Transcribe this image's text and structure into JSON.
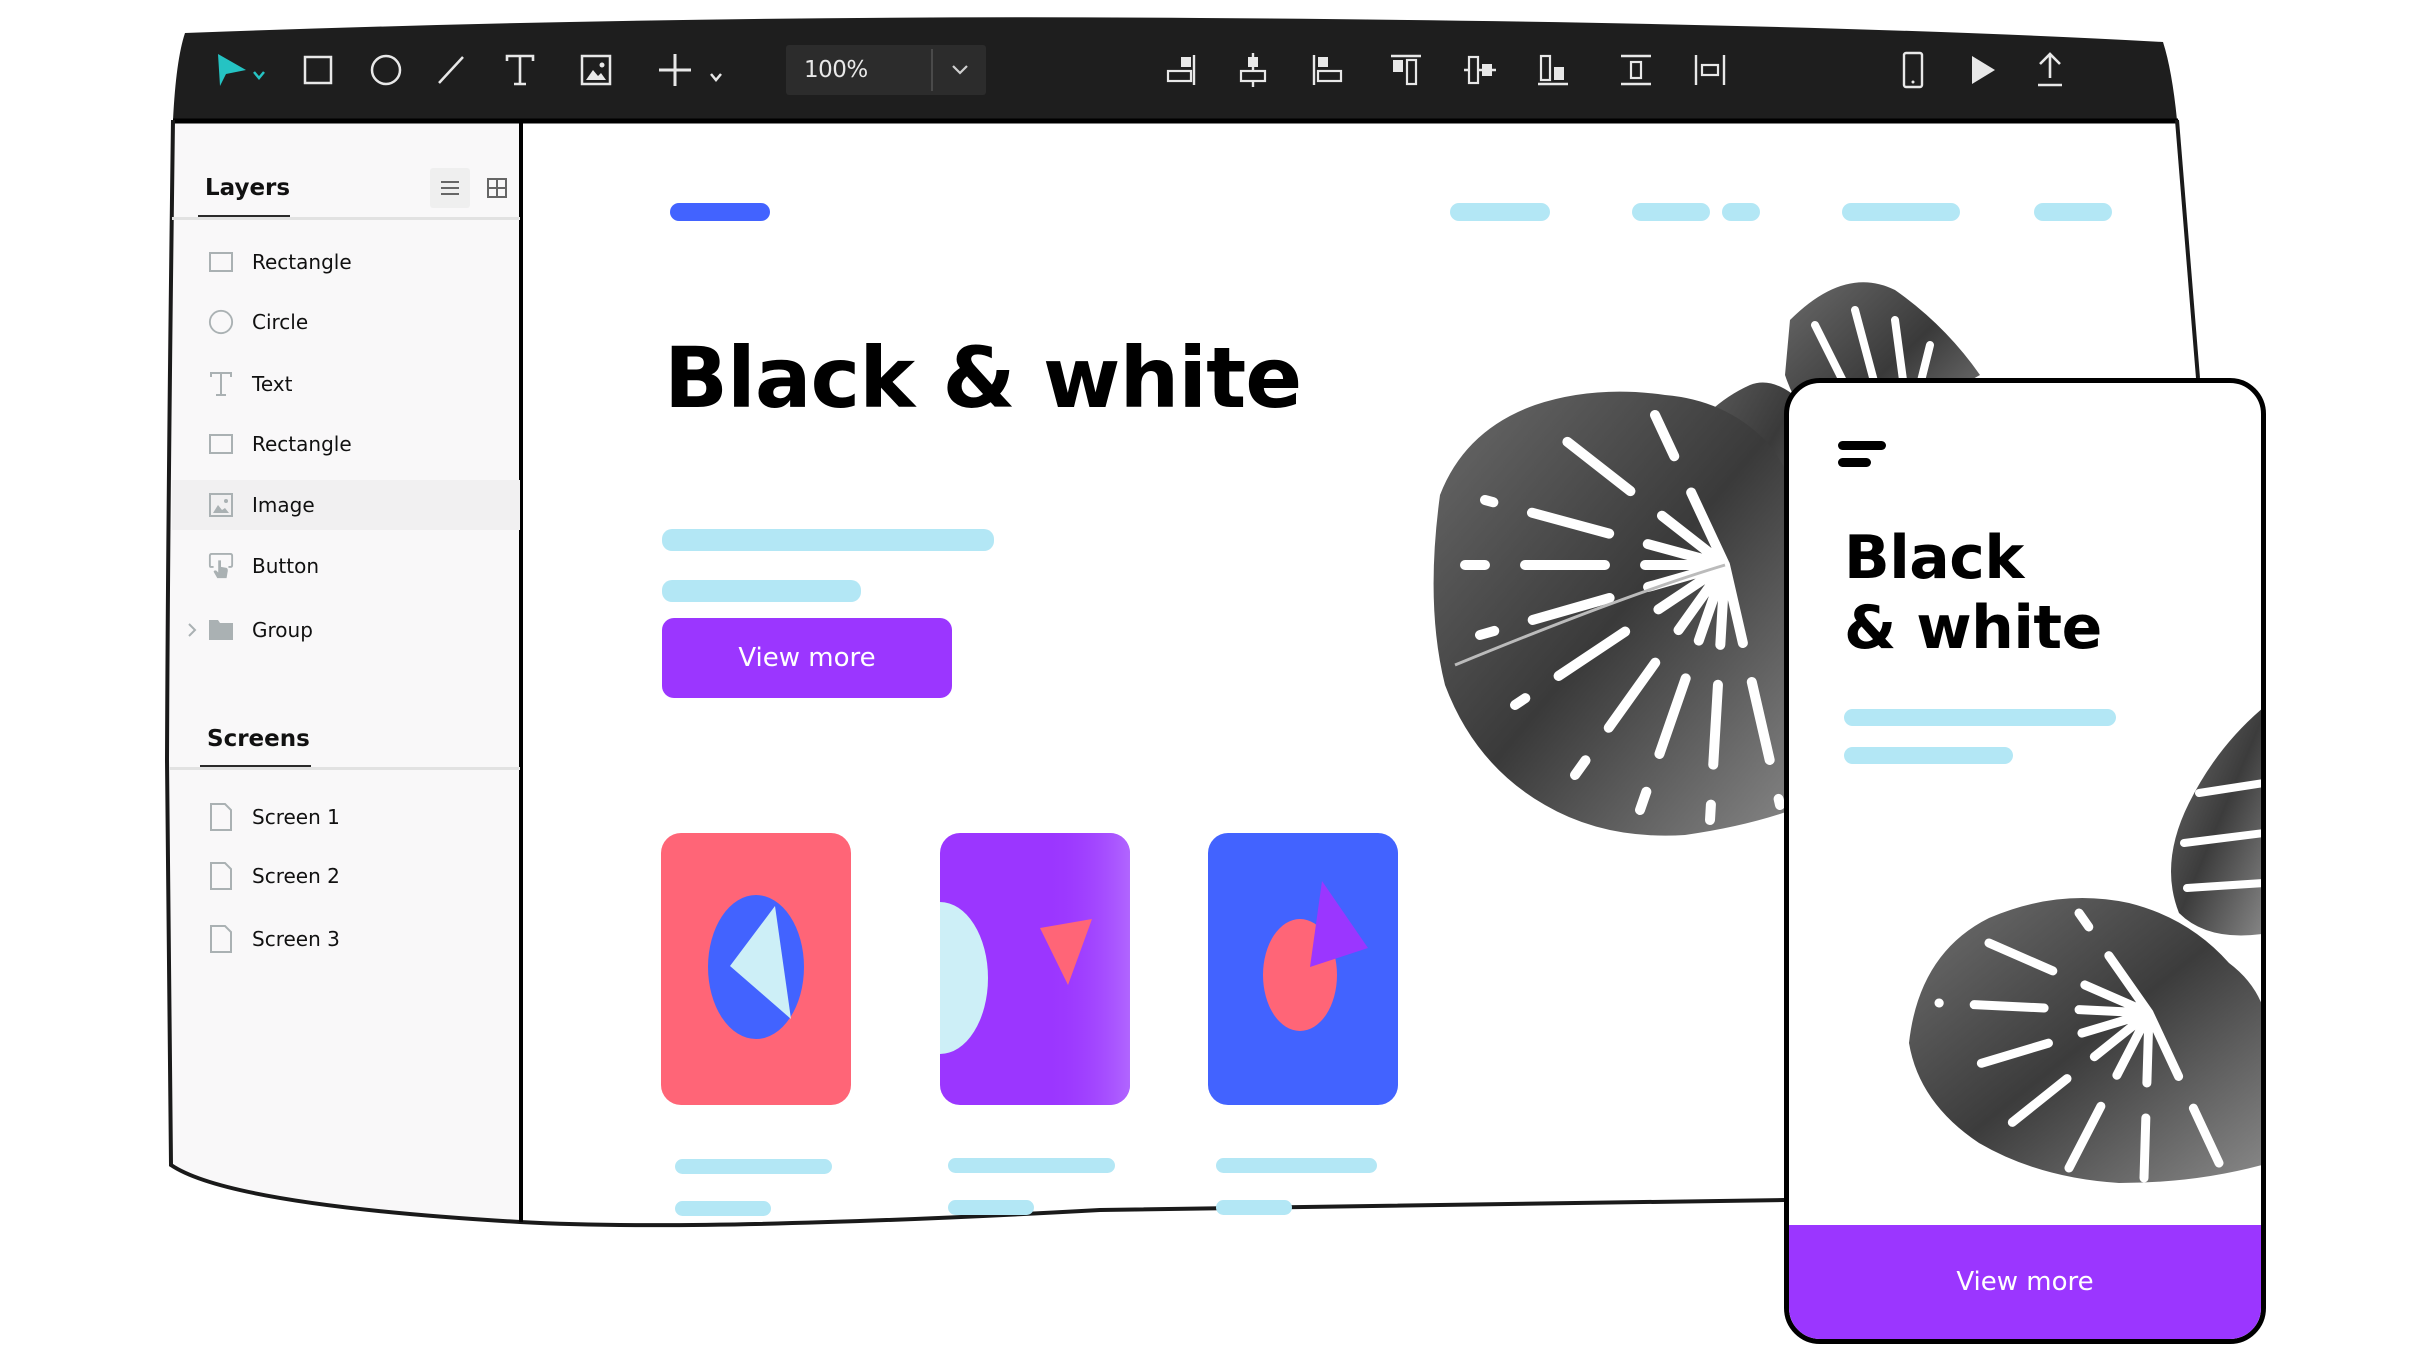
{
  "colors": {
    "toolbar_bg": "#1e1e1e",
    "accent_teal": "#25C3C3",
    "primary_purple": "#9B36FF",
    "blue": "#4263FF",
    "coral": "#FF6577",
    "placeholder_line": "#B3E7F5",
    "pale_cyan": "#CDEFF7",
    "sidebar_bg": "#F9F8F9"
  },
  "toolbar": {
    "tools": [
      {
        "name": "select-tool",
        "icon": "cursor-arrow-icon",
        "active": true,
        "has_dropdown": true
      },
      {
        "name": "rectangle-tool",
        "icon": "rectangle-icon"
      },
      {
        "name": "ellipse-tool",
        "icon": "circle-icon"
      },
      {
        "name": "line-tool",
        "icon": "line-icon"
      },
      {
        "name": "text-tool",
        "icon": "text-icon"
      },
      {
        "name": "image-tool",
        "icon": "image-icon"
      },
      {
        "name": "add-tool",
        "icon": "plus-icon",
        "has_dropdown": true
      }
    ],
    "zoom_level": "100%",
    "align_tools": [
      {
        "name": "align-right",
        "icon": "align-right-icon"
      },
      {
        "name": "align-horizontal-center",
        "icon": "align-horizontal-center-icon"
      },
      {
        "name": "align-left",
        "icon": "align-left-icon"
      },
      {
        "name": "align-top",
        "icon": "align-top-icon"
      },
      {
        "name": "align-vertical-center",
        "icon": "align-vertical-center-icon"
      },
      {
        "name": "align-bottom",
        "icon": "align-bottom-icon"
      },
      {
        "name": "distribute-vertical",
        "icon": "distribute-vertical-icon"
      },
      {
        "name": "distribute-horizontal",
        "icon": "distribute-horizontal-icon"
      }
    ],
    "right_actions": [
      {
        "name": "device-preview",
        "icon": "mobile-device-icon"
      },
      {
        "name": "play-preview",
        "icon": "play-icon"
      },
      {
        "name": "export",
        "icon": "upload-icon"
      }
    ]
  },
  "layers_panel": {
    "title": "Layers",
    "view_modes": [
      "list-view-icon",
      "grid-view-icon"
    ],
    "active_view": "list",
    "items": [
      {
        "label": "Rectangle",
        "icon": "rectangle-icon"
      },
      {
        "label": "Circle",
        "icon": "circle-icon"
      },
      {
        "label": "Text",
        "icon": "text-icon"
      },
      {
        "label": "Rectangle",
        "icon": "rectangle-icon"
      },
      {
        "label": "Image",
        "icon": "image-icon",
        "selected": true
      },
      {
        "label": "Button",
        "icon": "button-pointer-icon"
      },
      {
        "label": "Group",
        "icon": "folder-icon",
        "expandable": true
      }
    ]
  },
  "screens_panel": {
    "title": "Screens",
    "items": [
      {
        "label": "Screen 1",
        "icon": "page-icon"
      },
      {
        "label": "Screen 2",
        "icon": "page-icon"
      },
      {
        "label": "Screen 3",
        "icon": "page-icon"
      }
    ]
  },
  "canvas": {
    "hero_title": "Black & white",
    "cta_label": "View more",
    "cards": [
      {
        "name": "coral-card",
        "bg": "#FF6577"
      },
      {
        "name": "purple-card",
        "bg": "#9B36FF"
      },
      {
        "name": "blue-card",
        "bg": "#4263FF"
      }
    ]
  },
  "phone_preview": {
    "title_line1": "Black",
    "title_line2": "& white",
    "cta_label": "View more",
    "menu_icon": "hamburger-menu-icon"
  }
}
